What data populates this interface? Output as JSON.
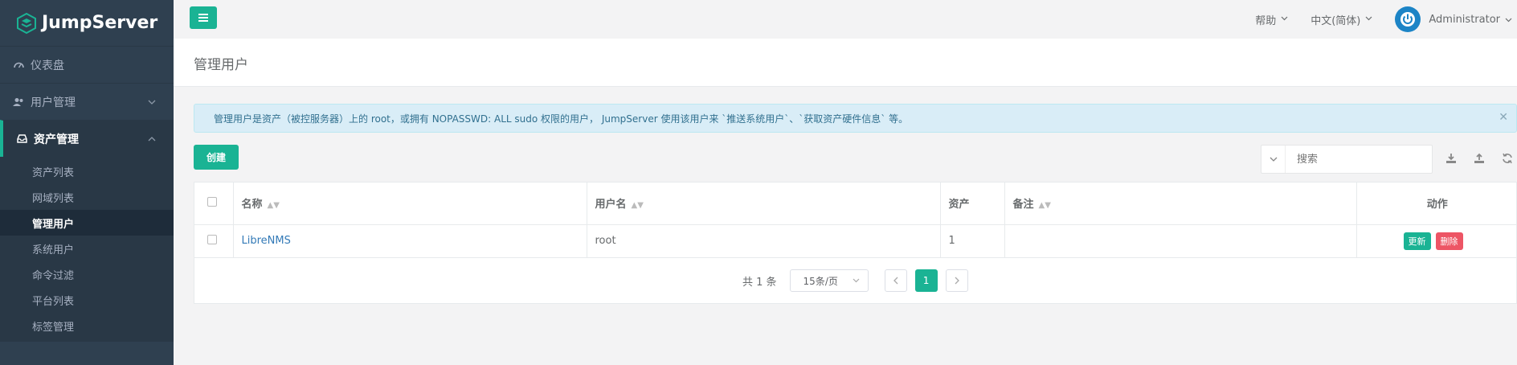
{
  "brand": {
    "name": "JumpServer",
    "accent": "#1ab394"
  },
  "sidebar": {
    "items": [
      {
        "label": "仪表盘",
        "icon": "dashboard-icon"
      },
      {
        "label": "用户管理",
        "icon": "users-icon",
        "expanded": false
      },
      {
        "label": "资产管理",
        "icon": "inbox-icon",
        "expanded": true,
        "children": [
          {
            "label": "资产列表"
          },
          {
            "label": "网域列表"
          },
          {
            "label": "管理用户",
            "current": true
          },
          {
            "label": "系统用户"
          },
          {
            "label": "命令过滤"
          },
          {
            "label": "平台列表"
          },
          {
            "label": "标签管理"
          }
        ]
      }
    ]
  },
  "topbar": {
    "help_label": "帮助",
    "language_label": "中文(简体)",
    "user_label": "Administrator"
  },
  "page": {
    "title": "管理用户"
  },
  "alert": {
    "text": "管理用户是资产（被控服务器）上的 root，或拥有 NOPASSWD: ALL sudo 权限的用户， JumpServer 使用该用户来 `推送系统用户`、`获取资产硬件信息` 等。"
  },
  "toolbar": {
    "create_label": "创建",
    "search_placeholder": "搜索"
  },
  "table": {
    "headers": {
      "name": "名称",
      "username": "用户名",
      "assets": "资产",
      "comment": "备注",
      "actions": "动作"
    },
    "rows": [
      {
        "name": "LibreNMS",
        "username": "root",
        "assets": "1",
        "comment": "",
        "update_label": "更新",
        "delete_label": "删除"
      }
    ]
  },
  "pagination": {
    "total_label": "共 1 条",
    "per_page_label": "15条/页",
    "current_page": "1"
  }
}
